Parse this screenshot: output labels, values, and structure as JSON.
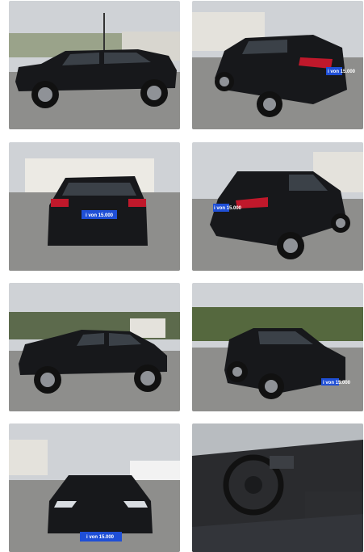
{
  "gallery": {
    "photos": [
      {
        "alt": "Black SUV side view",
        "icon": "car-side-photo"
      },
      {
        "alt": "Black SUV rear three-quarter view",
        "icon": "car-rear-quarter-photo",
        "plate": "i von 15.000"
      },
      {
        "alt": "Black SUV rear view",
        "icon": "car-rear-photo",
        "plate": "i von 15.000"
      },
      {
        "alt": "Black SUV rear three-quarter left view",
        "icon": "car-rear-quarter-photo",
        "plate": "i von 15.000"
      },
      {
        "alt": "Black SUV side profile",
        "icon": "car-side-photo"
      },
      {
        "alt": "Black SUV front three-quarter view",
        "icon": "car-front-quarter-photo",
        "plate": "i von 15.000"
      },
      {
        "alt": "Black SUV front view",
        "icon": "car-front-photo",
        "plate": "i von 15.000"
      },
      {
        "alt": "Interior dashboard and steering wheel",
        "icon": "car-interior-photo"
      }
    ]
  },
  "colors": {
    "car_body": "#17181b",
    "sky": "#c9ccd0",
    "pavement": "#8a8a88",
    "plate_blue": "#1f4fd6"
  }
}
